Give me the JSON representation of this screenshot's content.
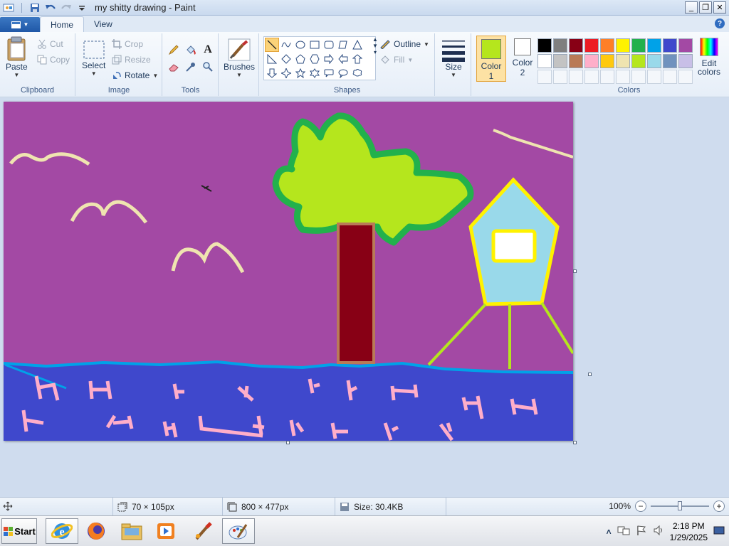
{
  "window": {
    "title": "my shitty drawing - Paint",
    "buttons": {
      "minimize": "_",
      "restore": "❐",
      "close": "✕"
    }
  },
  "tabs": {
    "home": "Home",
    "view": "View"
  },
  "ribbon": {
    "clipboard": {
      "label": "Clipboard",
      "paste": "Paste",
      "cut": "Cut",
      "copy": "Copy"
    },
    "image": {
      "label": "Image",
      "select": "Select",
      "crop": "Crop",
      "resize": "Resize",
      "rotate": "Rotate"
    },
    "tools": {
      "label": "Tools"
    },
    "brushes": {
      "label": "Brushes"
    },
    "shapes": {
      "label": "Shapes",
      "outline": "Outline",
      "fill": "Fill"
    },
    "size": {
      "label": "Size"
    },
    "colors": {
      "label": "Colors",
      "color1": {
        "line1": "Color",
        "line2": "1",
        "value": "#b5e61d"
      },
      "color2": {
        "line1": "Color",
        "line2": "2",
        "value": "#ffffff"
      },
      "edit_line1": "Edit",
      "edit_line2": "colors",
      "palette": [
        "#000000",
        "#7f7f7f",
        "#880015",
        "#ed1c24",
        "#ff7f27",
        "#fff200",
        "#22b14c",
        "#00a2e8",
        "#3f48cc",
        "#a349a4",
        "#ffffff",
        "#c3c3c3",
        "#b97a57",
        "#ffaec9",
        "#ffc90e",
        "#efe4b0",
        "#b5e61d",
        "#99d9ea",
        "#7092be",
        "#c8bfe7"
      ]
    }
  },
  "status": {
    "selection": "70 × 105px",
    "canvas_size": "800 × 477px",
    "file_size": "Size: 30.4KB",
    "zoom": "100%"
  },
  "taskbar": {
    "start": "Start",
    "time": "2:18 PM",
    "date": "1/29/2025"
  }
}
